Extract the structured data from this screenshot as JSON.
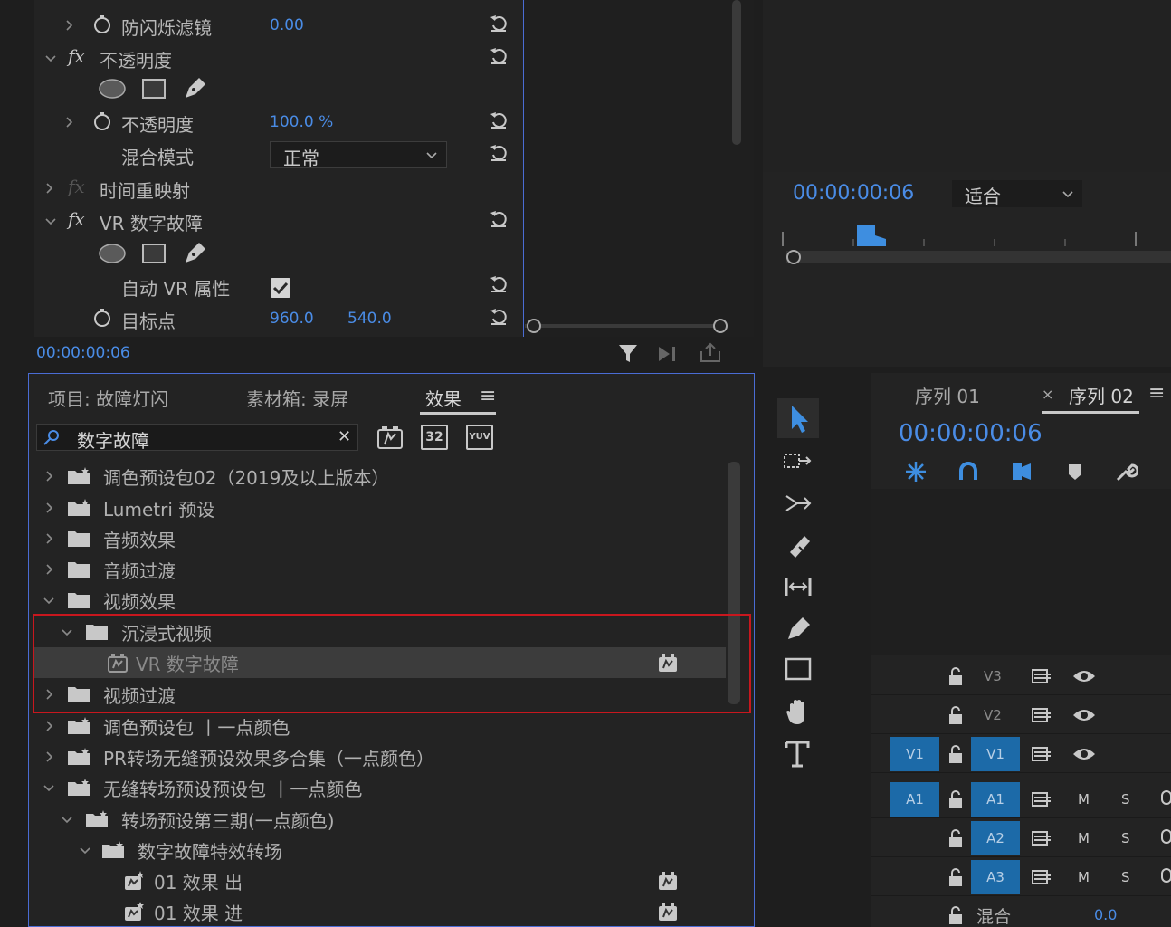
{
  "effect_controls": {
    "rows": [
      {
        "label": "防闪烁滤镜",
        "value": "0.00"
      },
      {
        "label": "不透明度"
      },
      {
        "label": "不透明度",
        "value": "100.0 %"
      },
      {
        "label": "混合模式",
        "value": "正常"
      },
      {
        "label": "时间重映射"
      },
      {
        "label": "VR 数字故障"
      },
      {
        "label": "自动 VR 属性"
      },
      {
        "label": "目标点",
        "value": "960.0",
        "value2": "540.0"
      }
    ],
    "fx_symbol": "fx",
    "timecode": "00:00:00:06"
  },
  "program_monitor": {
    "timecode": "00:00:00:06",
    "zoom": "适合"
  },
  "project_panel": {
    "tabs": [
      "项目: 故障灯闪",
      "素材箱: 录屏",
      "效果"
    ],
    "menu_icon": "≡",
    "search": {
      "value": "数字故障",
      "clear": "✕"
    },
    "badges": [
      "32",
      "YUV"
    ],
    "tree": [
      {
        "label": "调色预设包02（2019及以上版本）"
      },
      {
        "label": "Lumetri 预设"
      },
      {
        "label": "音频效果"
      },
      {
        "label": "音频过渡"
      },
      {
        "label": "视频效果"
      },
      {
        "label": "沉浸式视频"
      },
      {
        "label": "VR 数字故障"
      },
      {
        "label": "视频过渡"
      },
      {
        "label": "调色预设包 丨一点颜色"
      },
      {
        "label": "PR转场无缝预设效果多合集（一点颜色）"
      },
      {
        "label": "无缝转场预设预设包 丨一点颜色"
      },
      {
        "label": "转场预设第三期(一点颜色)"
      },
      {
        "label": "数字故障特效转场"
      },
      {
        "label": "01 效果 出"
      },
      {
        "label": "01 效果 进"
      }
    ],
    "highlight_color": "#c8171e"
  },
  "timeline": {
    "tabs": [
      "序列 01",
      "序列 02"
    ],
    "close": "×",
    "menu_icon": "≡",
    "timecode": "00:00:00:06",
    "tracks": [
      {
        "name": "V3"
      },
      {
        "name": "V2"
      },
      {
        "name": "V1",
        "src": "V1"
      },
      {
        "name": "A1",
        "src": "A1",
        "m": "M",
        "s": "S"
      },
      {
        "name": "A2",
        "m": "M",
        "s": "S"
      },
      {
        "name": "A3",
        "m": "M",
        "s": "S"
      }
    ],
    "mix": {
      "label": "混合",
      "value": "0.0"
    }
  },
  "colors": {
    "accent": "#4a8ce6",
    "track_blue": "#1c6aa8"
  }
}
